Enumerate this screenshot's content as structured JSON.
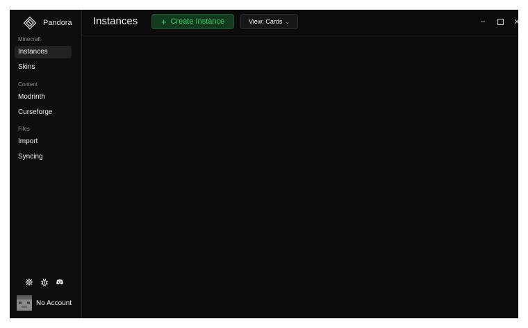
{
  "app": {
    "name": "Pandora"
  },
  "sidebar": {
    "sections": [
      {
        "label": "Minecraft",
        "items": [
          {
            "label": "Instances",
            "active": true
          },
          {
            "label": "Skins"
          }
        ]
      },
      {
        "label": "Content",
        "items": [
          {
            "label": "Modrinth"
          },
          {
            "label": "Curseforge"
          }
        ]
      },
      {
        "label": "Files",
        "items": [
          {
            "label": "Import"
          },
          {
            "label": "Syncing"
          }
        ]
      }
    ],
    "bottom_icons": [
      "settings-icon",
      "bug-icon",
      "discord-icon"
    ],
    "account": {
      "label": "No Account"
    }
  },
  "header": {
    "title": "Instances",
    "create_label": "Create Instance",
    "create_icon": "plus-icon",
    "view_label": "View: Cards",
    "view_icon": "chevron-down-icon"
  },
  "window_controls": [
    "minimize-icon",
    "maximize-icon",
    "close-icon"
  ],
  "colors": {
    "background": "#0b0b0b",
    "sidebar": "#0e0e0e",
    "accent": "#3fd06a",
    "accent_bg": "#123a1e",
    "active_item": "#222222"
  }
}
